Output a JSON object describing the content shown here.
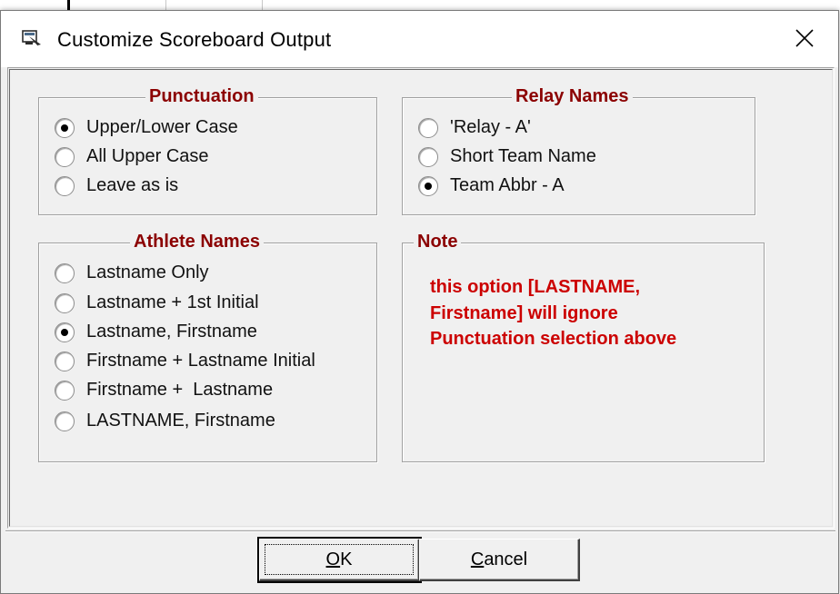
{
  "dialog": {
    "title": "Customize Scoreboard Output",
    "close_symbol": "✕"
  },
  "punctuation": {
    "title": "Punctuation",
    "options": [
      {
        "label": "Upper/Lower Case",
        "checked": true
      },
      {
        "label": "All Upper Case",
        "checked": false
      },
      {
        "label": "Leave as is",
        "checked": false
      }
    ]
  },
  "relay_names": {
    "title": "Relay Names",
    "options": [
      {
        "label": "'Relay - A'",
        "checked": false
      },
      {
        "label": "Short Team Name",
        "checked": false
      },
      {
        "label": "Team Abbr - A",
        "checked": true
      }
    ]
  },
  "athlete_names": {
    "title": "Athlete Names",
    "options": [
      {
        "label": "Lastname Only",
        "checked": false
      },
      {
        "label": "Lastname + 1st Initial",
        "checked": false
      },
      {
        "label": "Lastname, Firstname",
        "checked": true
      },
      {
        "label": "Firstname + Lastname Initial",
        "checked": false
      },
      {
        "label": "Firstname +  Lastname",
        "checked": false
      },
      {
        "label": "LASTNAME, Firstname",
        "checked": false
      }
    ]
  },
  "note": {
    "title": "Note",
    "line1": "this option [LASTNAME,",
    "line2": "Firstname] will ignore",
    "line3": "Punctuation selection above"
  },
  "buttons": {
    "ok_mnemonic": "O",
    "ok_rest": "K",
    "cancel_mnemonic": "C",
    "cancel_rest": "ancel"
  },
  "colors": {
    "group_title": "#8b0000",
    "note_text": "#cc0000",
    "dialog_bg": "#f0f0f0"
  },
  "icons": {
    "title_icon": "scoreboard-app-icon",
    "close_icon": "close-icon"
  }
}
